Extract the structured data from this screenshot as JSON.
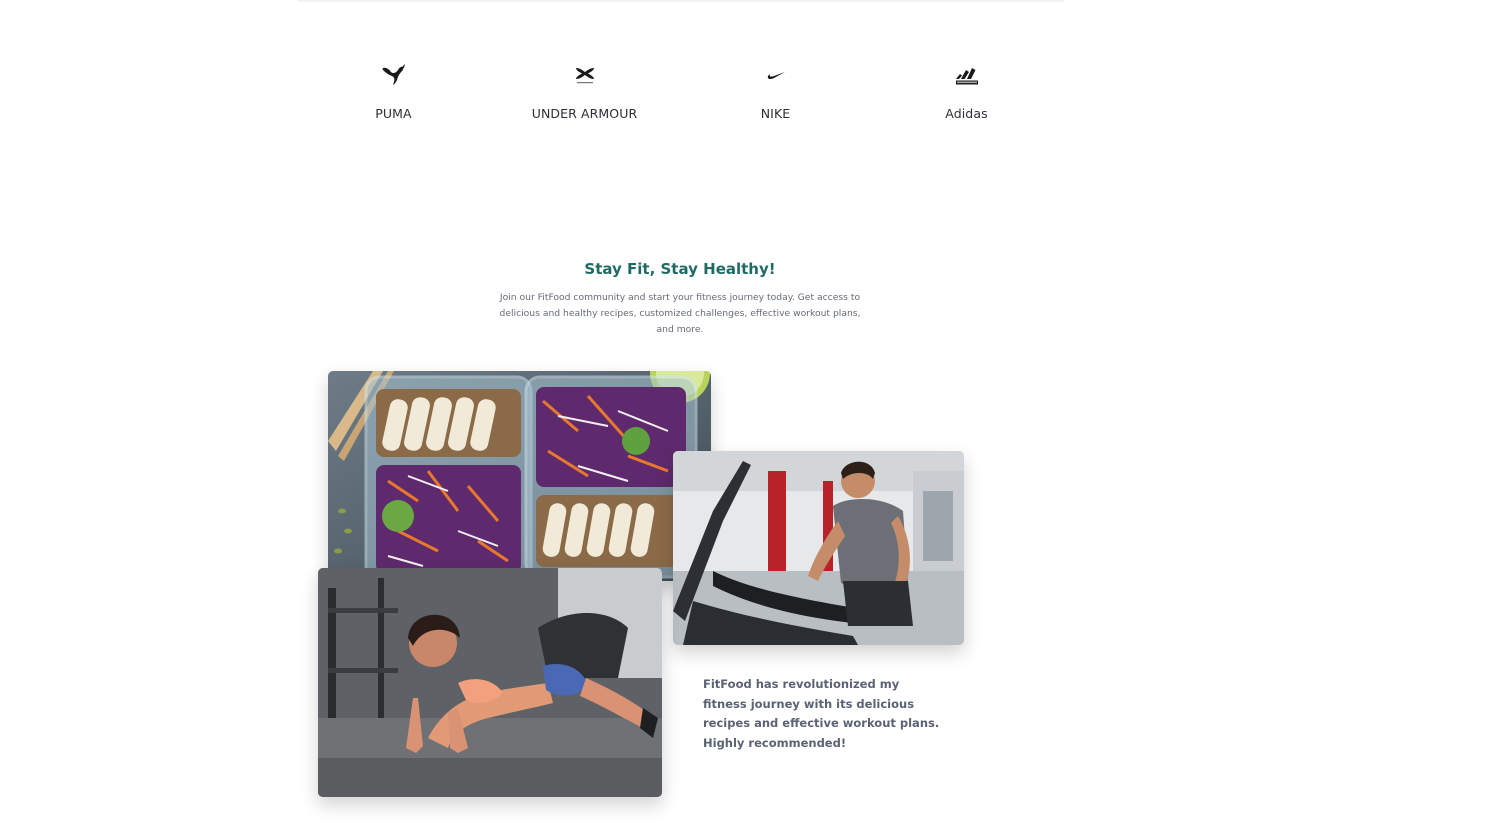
{
  "brands": [
    {
      "name": "PUMA",
      "icon": "puma-logo-icon"
    },
    {
      "name": "UNDER ARMOUR",
      "icon": "under-armour-logo-icon"
    },
    {
      "name": "NIKE",
      "icon": "nike-swoosh-icon"
    },
    {
      "name": "Adidas",
      "icon": "adidas-logo-icon"
    }
  ],
  "hero": {
    "title": "Stay Fit, Stay Healthy!",
    "description": "Join our FitFood community and start your fitness journey today. Get access to delicious and healthy recipes, customized challenges, effective workout plans, and more."
  },
  "testimonial": {
    "quote": "FitFood has revolutionized my fitness journey with its delicious recipes and effective workout plans. Highly recommended!"
  },
  "colors": {
    "title": "#1f6b64",
    "body_text": "#646b78",
    "quote_text": "#5b6274",
    "brand_text": "#2b2f33"
  }
}
